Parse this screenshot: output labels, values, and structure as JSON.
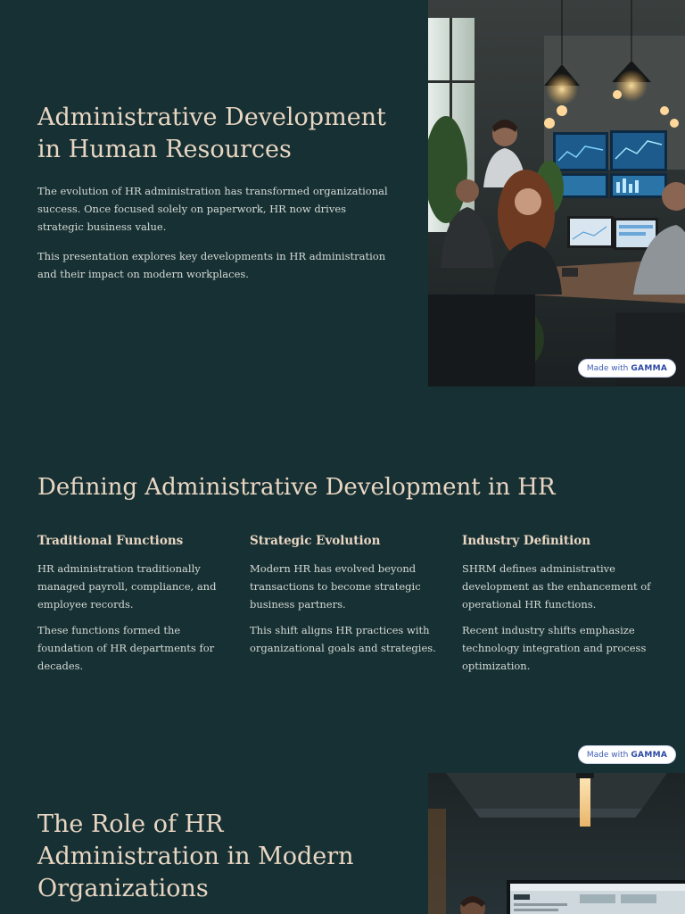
{
  "slides": [
    {
      "title_line1": "Administrative Development",
      "title_line2": "in Human Resources",
      "paragraphs": [
        "The evolution of HR administration has transformed organizational success. Once focused solely on paperwork, HR now drives strategic business value.",
        "This presentation explores key developments in HR administration and their impact on modern workplaces."
      ],
      "image": "office-team-dashboard-photo"
    },
    {
      "title": "Defining Administrative Development in HR",
      "columns": [
        {
          "heading": "Traditional Functions",
          "paragraphs": [
            "HR administration traditionally managed payroll, compliance, and employee records.",
            "These functions formed the foundation of HR departments for decades."
          ]
        },
        {
          "heading": "Strategic Evolution",
          "paragraphs": [
            "Modern HR has evolved beyond transactions to become strategic business partners.",
            "This shift aligns HR practices with organizational goals and strategies."
          ]
        },
        {
          "heading": "Industry Definition",
          "paragraphs": [
            "SHRM defines administrative development as the enhancement of operational HR functions.",
            "Recent industry shifts emphasize technology integration and process optimization."
          ]
        }
      ]
    },
    {
      "title_line1": "The Role of HR",
      "title_line2": "Administration in Modern",
      "title_line3": "Organizations",
      "image": "office-monitor-photo"
    }
  ],
  "badge": {
    "prefix": "Made with",
    "brand": "GAMMA"
  },
  "colors": {
    "background": "#173033",
    "heading": "#e8d6c3",
    "body_text": "#d5dad6",
    "badge_text": "#3f5fb6"
  }
}
